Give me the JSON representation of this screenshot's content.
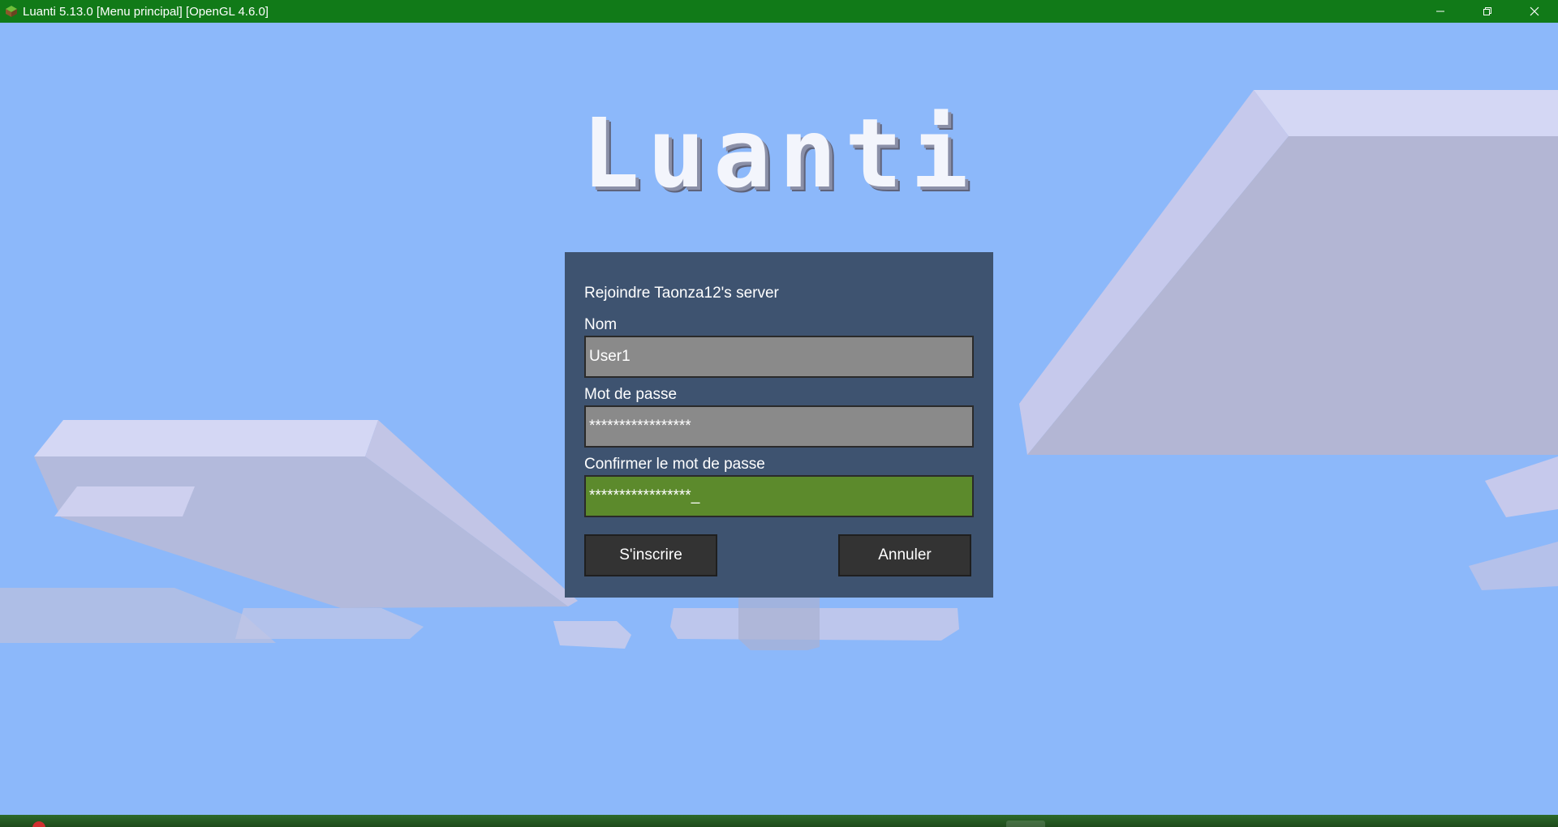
{
  "window": {
    "title": "Luanti 5.13.0 [Menu principal] [OpenGL 4.6.0]",
    "controls": [
      "minimize-icon",
      "restore-icon",
      "close-icon"
    ],
    "titlebar_color": "#117a18"
  },
  "logo": {
    "text": "Luanti"
  },
  "dialog": {
    "title": "Rejoindre Taonza12's server",
    "name_label": "Nom",
    "name_value": "User1",
    "password_label": "Mot de passe",
    "password_value": "*****************",
    "confirm_label": "Confirmer le mot de passe",
    "confirm_value": "*****************",
    "cursor": "_",
    "register_button": "S'inscrire",
    "cancel_button": "Annuler",
    "background_color": "#3e5370",
    "active_field_color": "#5c8a2c"
  },
  "sky_color": "#8cb8fa"
}
